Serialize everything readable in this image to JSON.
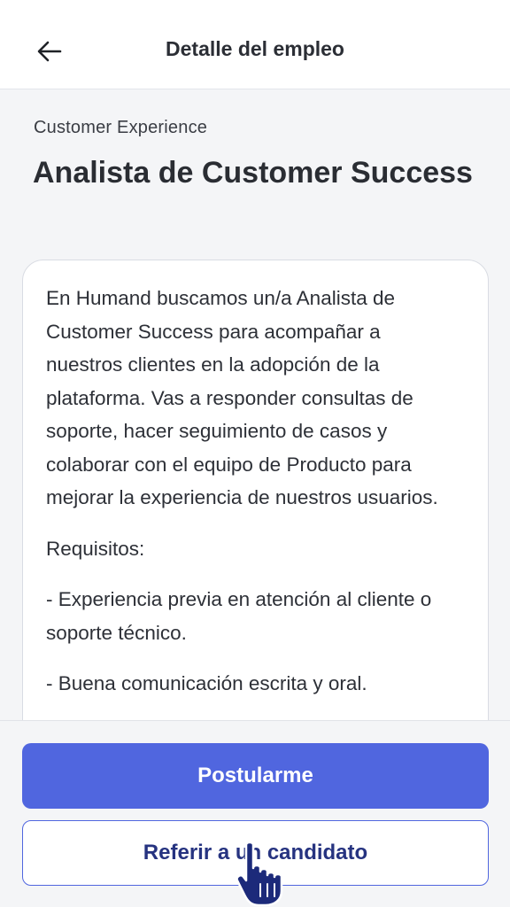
{
  "header": {
    "title": "Detalle del empleo",
    "back_icon": "arrow-left-icon"
  },
  "job": {
    "category": "Customer Experience",
    "title": "Analista de Customer Success",
    "description": [
      "En Humand buscamos un/a Analista de Customer Success para acompañar a nuestros clientes en la adopción de la plataforma. Vas a responder consultas de soporte, hacer seguimiento de casos y colaborar con el equipo de Producto para mejorar la experiencia de nuestros usuarios.",
      "Requisitos:",
      "- Experiencia previa en atención al cliente o soporte técnico.",
      "- Buena comunicación escrita y oral."
    ]
  },
  "actions": {
    "apply_label": "Postularme",
    "refer_label": "Referir a un candidato"
  },
  "colors": {
    "primary": "#5066df",
    "refer_text": "#263380",
    "background": "#f4f5f7"
  }
}
